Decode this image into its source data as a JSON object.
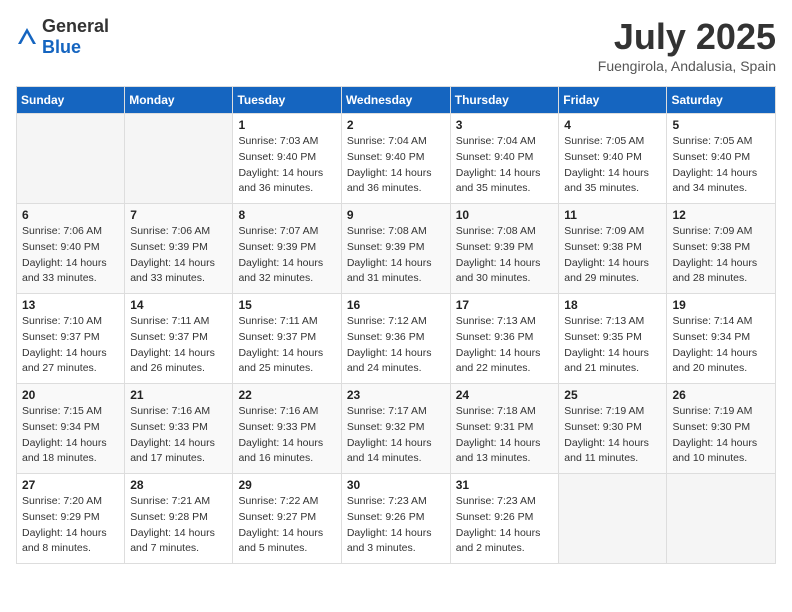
{
  "logo": {
    "general": "General",
    "blue": "Blue"
  },
  "header": {
    "month": "July 2025",
    "location": "Fuengirola, Andalusia, Spain"
  },
  "days_of_week": [
    "Sunday",
    "Monday",
    "Tuesday",
    "Wednesday",
    "Thursday",
    "Friday",
    "Saturday"
  ],
  "weeks": [
    [
      {
        "day": "",
        "sunrise": "",
        "sunset": "",
        "daylight": ""
      },
      {
        "day": "",
        "sunrise": "",
        "sunset": "",
        "daylight": ""
      },
      {
        "day": "1",
        "sunrise": "Sunrise: 7:03 AM",
        "sunset": "Sunset: 9:40 PM",
        "daylight": "Daylight: 14 hours and 36 minutes."
      },
      {
        "day": "2",
        "sunrise": "Sunrise: 7:04 AM",
        "sunset": "Sunset: 9:40 PM",
        "daylight": "Daylight: 14 hours and 36 minutes."
      },
      {
        "day": "3",
        "sunrise": "Sunrise: 7:04 AM",
        "sunset": "Sunset: 9:40 PM",
        "daylight": "Daylight: 14 hours and 35 minutes."
      },
      {
        "day": "4",
        "sunrise": "Sunrise: 7:05 AM",
        "sunset": "Sunset: 9:40 PM",
        "daylight": "Daylight: 14 hours and 35 minutes."
      },
      {
        "day": "5",
        "sunrise": "Sunrise: 7:05 AM",
        "sunset": "Sunset: 9:40 PM",
        "daylight": "Daylight: 14 hours and 34 minutes."
      }
    ],
    [
      {
        "day": "6",
        "sunrise": "Sunrise: 7:06 AM",
        "sunset": "Sunset: 9:40 PM",
        "daylight": "Daylight: 14 hours and 33 minutes."
      },
      {
        "day": "7",
        "sunrise": "Sunrise: 7:06 AM",
        "sunset": "Sunset: 9:39 PM",
        "daylight": "Daylight: 14 hours and 33 minutes."
      },
      {
        "day": "8",
        "sunrise": "Sunrise: 7:07 AM",
        "sunset": "Sunset: 9:39 PM",
        "daylight": "Daylight: 14 hours and 32 minutes."
      },
      {
        "day": "9",
        "sunrise": "Sunrise: 7:08 AM",
        "sunset": "Sunset: 9:39 PM",
        "daylight": "Daylight: 14 hours and 31 minutes."
      },
      {
        "day": "10",
        "sunrise": "Sunrise: 7:08 AM",
        "sunset": "Sunset: 9:39 PM",
        "daylight": "Daylight: 14 hours and 30 minutes."
      },
      {
        "day": "11",
        "sunrise": "Sunrise: 7:09 AM",
        "sunset": "Sunset: 9:38 PM",
        "daylight": "Daylight: 14 hours and 29 minutes."
      },
      {
        "day": "12",
        "sunrise": "Sunrise: 7:09 AM",
        "sunset": "Sunset: 9:38 PM",
        "daylight": "Daylight: 14 hours and 28 minutes."
      }
    ],
    [
      {
        "day": "13",
        "sunrise": "Sunrise: 7:10 AM",
        "sunset": "Sunset: 9:37 PM",
        "daylight": "Daylight: 14 hours and 27 minutes."
      },
      {
        "day": "14",
        "sunrise": "Sunrise: 7:11 AM",
        "sunset": "Sunset: 9:37 PM",
        "daylight": "Daylight: 14 hours and 26 minutes."
      },
      {
        "day": "15",
        "sunrise": "Sunrise: 7:11 AM",
        "sunset": "Sunset: 9:37 PM",
        "daylight": "Daylight: 14 hours and 25 minutes."
      },
      {
        "day": "16",
        "sunrise": "Sunrise: 7:12 AM",
        "sunset": "Sunset: 9:36 PM",
        "daylight": "Daylight: 14 hours and 24 minutes."
      },
      {
        "day": "17",
        "sunrise": "Sunrise: 7:13 AM",
        "sunset": "Sunset: 9:36 PM",
        "daylight": "Daylight: 14 hours and 22 minutes."
      },
      {
        "day": "18",
        "sunrise": "Sunrise: 7:13 AM",
        "sunset": "Sunset: 9:35 PM",
        "daylight": "Daylight: 14 hours and 21 minutes."
      },
      {
        "day": "19",
        "sunrise": "Sunrise: 7:14 AM",
        "sunset": "Sunset: 9:34 PM",
        "daylight": "Daylight: 14 hours and 20 minutes."
      }
    ],
    [
      {
        "day": "20",
        "sunrise": "Sunrise: 7:15 AM",
        "sunset": "Sunset: 9:34 PM",
        "daylight": "Daylight: 14 hours and 18 minutes."
      },
      {
        "day": "21",
        "sunrise": "Sunrise: 7:16 AM",
        "sunset": "Sunset: 9:33 PM",
        "daylight": "Daylight: 14 hours and 17 minutes."
      },
      {
        "day": "22",
        "sunrise": "Sunrise: 7:16 AM",
        "sunset": "Sunset: 9:33 PM",
        "daylight": "Daylight: 14 hours and 16 minutes."
      },
      {
        "day": "23",
        "sunrise": "Sunrise: 7:17 AM",
        "sunset": "Sunset: 9:32 PM",
        "daylight": "Daylight: 14 hours and 14 minutes."
      },
      {
        "day": "24",
        "sunrise": "Sunrise: 7:18 AM",
        "sunset": "Sunset: 9:31 PM",
        "daylight": "Daylight: 14 hours and 13 minutes."
      },
      {
        "day": "25",
        "sunrise": "Sunrise: 7:19 AM",
        "sunset": "Sunset: 9:30 PM",
        "daylight": "Daylight: 14 hours and 11 minutes."
      },
      {
        "day": "26",
        "sunrise": "Sunrise: 7:19 AM",
        "sunset": "Sunset: 9:30 PM",
        "daylight": "Daylight: 14 hours and 10 minutes."
      }
    ],
    [
      {
        "day": "27",
        "sunrise": "Sunrise: 7:20 AM",
        "sunset": "Sunset: 9:29 PM",
        "daylight": "Daylight: 14 hours and 8 minutes."
      },
      {
        "day": "28",
        "sunrise": "Sunrise: 7:21 AM",
        "sunset": "Sunset: 9:28 PM",
        "daylight": "Daylight: 14 hours and 7 minutes."
      },
      {
        "day": "29",
        "sunrise": "Sunrise: 7:22 AM",
        "sunset": "Sunset: 9:27 PM",
        "daylight": "Daylight: 14 hours and 5 minutes."
      },
      {
        "day": "30",
        "sunrise": "Sunrise: 7:23 AM",
        "sunset": "Sunset: 9:26 PM",
        "daylight": "Daylight: 14 hours and 3 minutes."
      },
      {
        "day": "31",
        "sunrise": "Sunrise: 7:23 AM",
        "sunset": "Sunset: 9:26 PM",
        "daylight": "Daylight: 14 hours and 2 minutes."
      },
      {
        "day": "",
        "sunrise": "",
        "sunset": "",
        "daylight": ""
      },
      {
        "day": "",
        "sunrise": "",
        "sunset": "",
        "daylight": ""
      }
    ]
  ]
}
